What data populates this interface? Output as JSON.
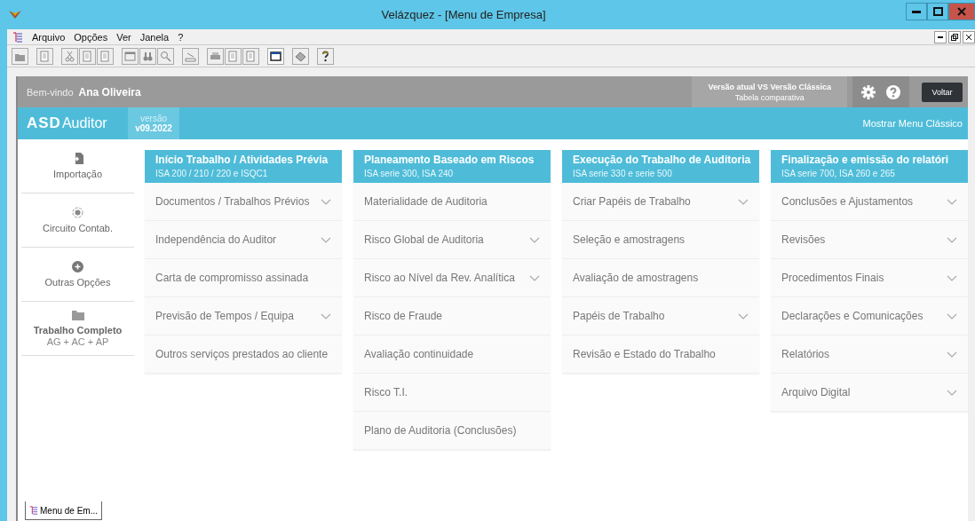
{
  "window": {
    "title": "Velázquez - [Menu de Empresa]"
  },
  "menu_bar": [
    "Arquivo",
    "Opções",
    "Ver",
    "Janela",
    "?"
  ],
  "header": {
    "welcome": "Bem-vindo",
    "user": "Ana Oliveira",
    "compare_title": "Versão atual VS Versão Clássica",
    "compare_subtitle": "Tabela comparativa",
    "back_button": "Voltar"
  },
  "brand_bar": {
    "logo": "ASD",
    "product": "Auditor",
    "version_label": "versão",
    "version": "v09.2022",
    "classic_link": "Mostrar Menu Clássico"
  },
  "sidebar": [
    {
      "label": "Importação",
      "kind": "import"
    },
    {
      "label": "Circuito Contab.",
      "kind": "circuit"
    },
    {
      "label": "Outras Opções",
      "kind": "plus"
    },
    {
      "label": "Trabalho Completo",
      "sublabel": "AG + AC + AP",
      "kind": "folder"
    }
  ],
  "columns": [
    {
      "title": "Início Trabalho / Atividades Prévia",
      "subtitle": "ISA 200 / 210 / 220 e ISQC1",
      "items": [
        {
          "label": "Documentos / Trabalhos Prévios",
          "has_submenu": true
        },
        {
          "label": "Independência do Auditor",
          "has_submenu": true
        },
        {
          "label": "Carta de compromisso assinada",
          "has_submenu": false
        },
        {
          "label": "Previsão de Tempos / Equipa",
          "has_submenu": true
        },
        {
          "label": "Outros serviços prestados ao cliente",
          "has_submenu": false
        }
      ]
    },
    {
      "title": "Planeamento Baseado em Riscos",
      "subtitle": "ISA serie 300, ISA 240",
      "items": [
        {
          "label": "Materialidade de Auditoria",
          "has_submenu": false
        },
        {
          "label": "Risco Global de Auditoria",
          "has_submenu": true
        },
        {
          "label": "Risco ao Nível da Rev. Analítica",
          "has_submenu": true
        },
        {
          "label": "Risco de Fraude",
          "has_submenu": false
        },
        {
          "label": "Avaliação continuidade",
          "has_submenu": false
        },
        {
          "label": "Risco T.I.",
          "has_submenu": false
        },
        {
          "label": "Plano de Auditoria (Conclusões)",
          "has_submenu": false
        }
      ]
    },
    {
      "title": "Execução do Trabalho de Auditoria",
      "subtitle": "ISA serie 330 e serie 500",
      "items": [
        {
          "label": "Criar Papéis de Trabalho",
          "has_submenu": true
        },
        {
          "label": "Seleção e amostragens",
          "has_submenu": false
        },
        {
          "label": "Avaliação de amostragens",
          "has_submenu": false
        },
        {
          "label": "Papéis de Trabalho",
          "has_submenu": true
        },
        {
          "label": "Revisão e Estado do Trabalho",
          "has_submenu": false
        }
      ]
    },
    {
      "title": "Finalização e emissão do relatóri",
      "subtitle": "ISA serie 700, ISA 260 e 265",
      "items": [
        {
          "label": "Conclusões e Ajustamentos",
          "has_submenu": true
        },
        {
          "label": "Revisões",
          "has_submenu": true
        },
        {
          "label": "Procedimentos Finais",
          "has_submenu": true
        },
        {
          "label": "Declarações e Comunicações",
          "has_submenu": true
        },
        {
          "label": "Relatórios",
          "has_submenu": true
        },
        {
          "label": "Arquivo Digital",
          "has_submenu": true
        }
      ]
    }
  ],
  "document_tabs": [
    {
      "label": "Menu de Em...",
      "selected": true
    }
  ]
}
